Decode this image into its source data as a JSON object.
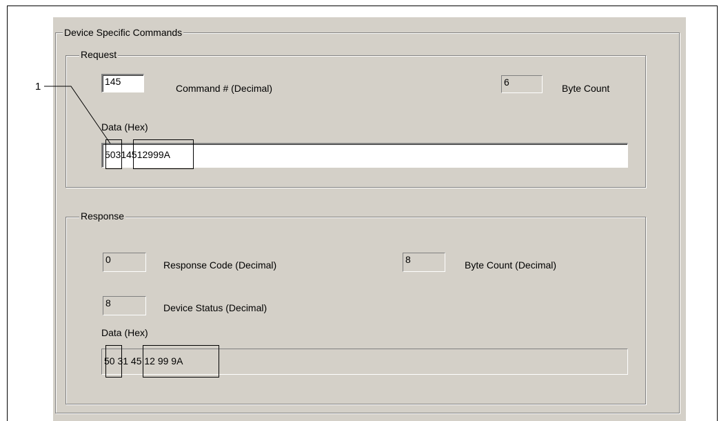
{
  "group": {
    "title": "Device Specific Commands"
  },
  "request": {
    "title": "Request",
    "command_value": "145",
    "command_label": "Command # (Decimal)",
    "byte_count_value": "6",
    "byte_count_label": "Byte Count",
    "data_label": "Data (Hex)",
    "data_value": "50314512999A"
  },
  "response": {
    "title": "Response",
    "response_code_value": "0",
    "response_code_label": "Response Code (Decimal)",
    "byte_count_value": "8",
    "byte_count_label": "Byte Count (Decimal)",
    "device_status_value": "8",
    "device_status_label": "Device Status (Decimal)",
    "data_label": "Data (Hex)",
    "data_value": "50 31 45 12 99 9A"
  },
  "callout": {
    "number": "1"
  }
}
